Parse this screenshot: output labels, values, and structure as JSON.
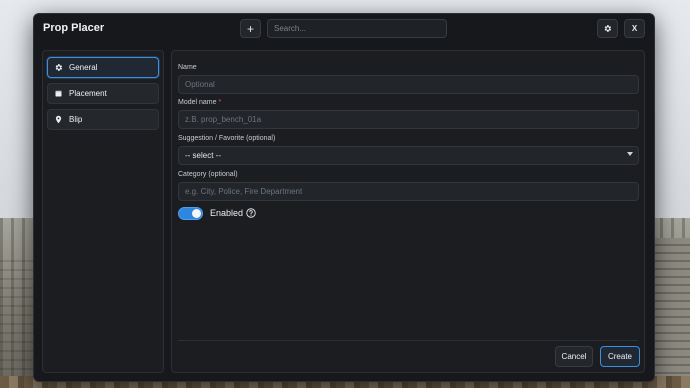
{
  "header": {
    "title": "Prop Placer",
    "add_label": "+",
    "search_placeholder": "Search...",
    "close_label": "X"
  },
  "sidebar": {
    "items": [
      {
        "label": "General",
        "icon": "gear-icon",
        "active": true
      },
      {
        "label": "Placement",
        "icon": "cube-icon",
        "active": false
      },
      {
        "label": "Blip",
        "icon": "map-pin-icon",
        "active": false
      }
    ]
  },
  "form": {
    "name": {
      "label": "Name",
      "placeholder": "Optional",
      "value": ""
    },
    "model_name": {
      "label": "Model name",
      "required_mark": "*",
      "placeholder": "z.B. prop_bench_01a",
      "value": ""
    },
    "suggestion": {
      "label": "Suggestion / Favorite (optional)",
      "selected": "-- select --"
    },
    "category": {
      "label": "Category (optional)",
      "placeholder": "e.g. City, Police, Fire Department",
      "value": ""
    },
    "enabled": {
      "label": "Enabled",
      "checked": true
    }
  },
  "footer": {
    "cancel_label": "Cancel",
    "create_label": "Create"
  },
  "colors": {
    "accent": "#2f86df",
    "window_bg": "#16181c",
    "required": "#e05555"
  }
}
